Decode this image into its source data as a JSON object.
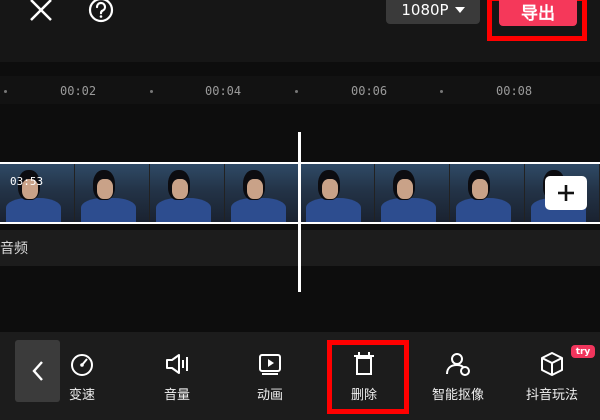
{
  "topbar": {
    "resolution": "1080P",
    "export_label": "导出"
  },
  "ruler": {
    "ticks": [
      "00:02",
      "00:04",
      "00:06",
      "00:08"
    ]
  },
  "timeline": {
    "clip_duration": "03:53",
    "audio_label": "音频"
  },
  "toolbar": {
    "items": [
      {
        "label": "变速",
        "icon": "speed-icon"
      },
      {
        "label": "音量",
        "icon": "volume-icon"
      },
      {
        "label": "动画",
        "icon": "animation-icon"
      },
      {
        "label": "删除",
        "icon": "delete-icon"
      },
      {
        "label": "智能抠像",
        "icon": "smart-cutout-icon"
      },
      {
        "label": "抖音玩法",
        "icon": "douyin-effects-icon"
      }
    ],
    "badge": "try"
  },
  "colors": {
    "accent": "#f5385a",
    "highlight": "#ff0000",
    "background": "#0d0d0d"
  }
}
